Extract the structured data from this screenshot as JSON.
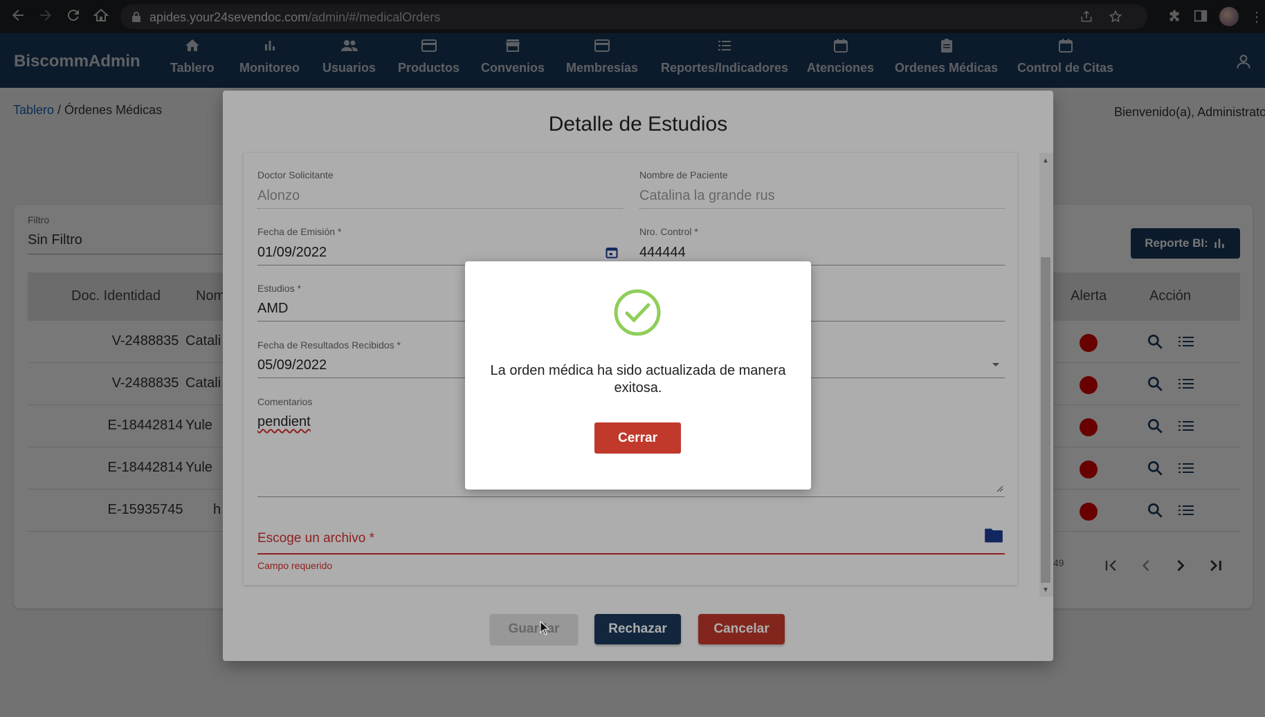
{
  "browser": {
    "url_domain": "apides.your24sevendoc.com",
    "url_path": "/admin/#/medicalOrders"
  },
  "app": {
    "brand": "BiscommAdmin",
    "nav": [
      {
        "label": "Tablero",
        "icon": "home-icon"
      },
      {
        "label": "Monitoreo",
        "icon": "bar-chart-icon"
      },
      {
        "label": "Usuarios",
        "icon": "people-icon"
      },
      {
        "label": "Productos",
        "icon": "card-icon"
      },
      {
        "label": "Convenios",
        "icon": "store-icon"
      },
      {
        "label": "Membresías",
        "icon": "card-icon"
      },
      {
        "label": "Reportes/Indicadores",
        "icon": "list-icon"
      },
      {
        "label": "Atenciones",
        "icon": "calendar-icon"
      },
      {
        "label": "Ordenes Médicas",
        "icon": "clipboard-icon"
      },
      {
        "label": "Control de Citas",
        "icon": "calendar-icon"
      }
    ]
  },
  "page": {
    "breadcrumb_link": "Tablero",
    "breadcrumb_current": " / Órdenes Médicas",
    "welcome": "Bienvenido(a), Administrator",
    "filter_label": "Filtro",
    "filter_value": "Sin Filtro",
    "report_button": "Reporte BI:",
    "columns": {
      "doc": "Doc. Identidad",
      "name": "Nom",
      "alert": "Alerta",
      "action": "Acción"
    },
    "rows": [
      {
        "doc": "V-2488835",
        "name": "Catali"
      },
      {
        "doc": "V-2488835",
        "name": "Catali"
      },
      {
        "doc": "E-18442814",
        "name": "Yule"
      },
      {
        "doc": "E-18442814",
        "name": "Yule"
      },
      {
        "doc": "E-15935745",
        "name": "h"
      }
    ],
    "pagination_range": "49"
  },
  "dialog": {
    "title": "Detalle de Estudios",
    "doctor_label": "Doctor Solicitante",
    "doctor_value": "Alonzo",
    "patient_label": "Nombre de Paciente",
    "patient_value": "Catalina la grande rus",
    "emission_label": "Fecha de Emisión *",
    "emission_value": "01/09/2022",
    "control_label": "Nro. Control *",
    "control_value": "444444",
    "studies_label": "Estudios *",
    "studies_value": "AMD",
    "results_label": "Fecha de Resultados Recibidos *",
    "results_value": "05/09/2022",
    "comments_label": "Comentarios",
    "comments_value": "pendient",
    "file_label": "Escoge un archivo *",
    "file_error": "Campo requerido",
    "save_button": "Guardar",
    "reject_button": "Rechazar",
    "cancel_button": "Cancelar"
  },
  "alert": {
    "message": "La orden médica ha sido actualizada de manera exitosa.",
    "close_button": "Cerrar"
  },
  "colors": {
    "header": "#1b3a5c",
    "danger": "#c0392b",
    "success": "#8fce5a",
    "error": "#d32f2f"
  }
}
